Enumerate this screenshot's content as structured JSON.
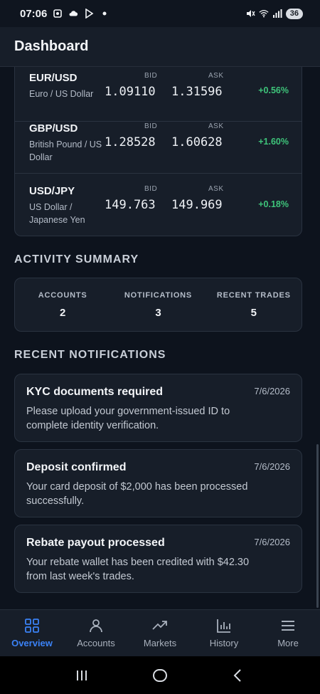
{
  "status_bar": {
    "time": "07:06",
    "battery": "36"
  },
  "header": {
    "title": "Dashboard"
  },
  "rates": {
    "bid_label": "BID",
    "ask_label": "ASK",
    "items": [
      {
        "pair": "EUR/USD",
        "desc": "Euro / US Dollar",
        "bid": "1.09110",
        "ask": "1.31596",
        "change": "+0.56%"
      },
      {
        "pair": "GBP/USD",
        "desc": "British Pound / US Dollar",
        "bid": "1.28528",
        "ask": "1.60628",
        "change": "+1.60%"
      },
      {
        "pair": "USD/JPY",
        "desc": "US Dollar / Japanese Yen",
        "bid": "149.763",
        "ask": "149.969",
        "change": "+0.18%"
      }
    ]
  },
  "activity": {
    "title": "ACTIVITY SUMMARY",
    "items": [
      {
        "label": "ACCOUNTS",
        "value": "2"
      },
      {
        "label": "NOTIFICATIONS",
        "value": "3"
      },
      {
        "label": "RECENT TRADES",
        "value": "5"
      }
    ]
  },
  "notifications": {
    "title": "RECENT NOTIFICATIONS",
    "items": [
      {
        "title": "KYC documents required",
        "date": "7/6/2026",
        "body": "Please upload your government-issued ID to complete identity verification."
      },
      {
        "title": "Deposit confirmed",
        "date": "7/6/2026",
        "body": "Your card deposit of $2,000 has been processed successfully."
      },
      {
        "title": "Rebate payout processed",
        "date": "7/6/2026",
        "body": "Your rebate wallet has been credited with $42.30 from last week's trades."
      }
    ]
  },
  "nav": {
    "items": [
      {
        "label": "Overview",
        "icon": "grid-icon",
        "active": true
      },
      {
        "label": "Accounts",
        "icon": "person-icon"
      },
      {
        "label": "Markets",
        "icon": "trending-icon"
      },
      {
        "label": "History",
        "icon": "bar-chart-icon"
      },
      {
        "label": "More",
        "icon": "menu-icon"
      }
    ]
  },
  "colors": {
    "accent": "#3b82f6",
    "positive": "#3ec47a",
    "background": "#0d131d",
    "card": "#171e29"
  }
}
